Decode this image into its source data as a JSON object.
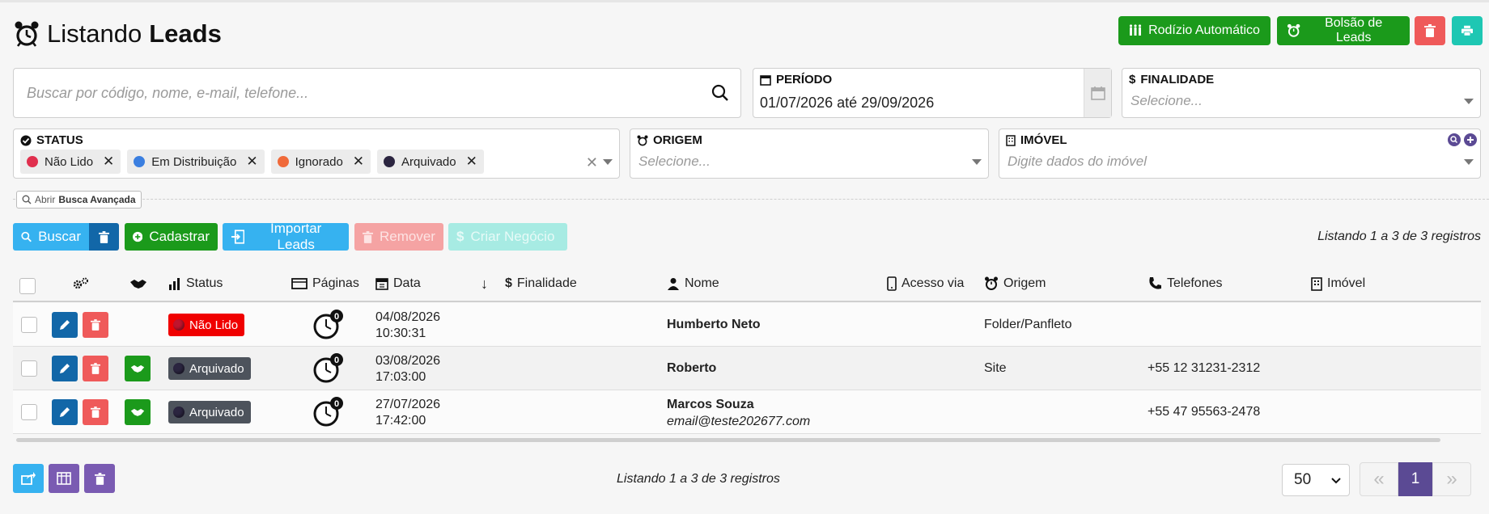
{
  "header": {
    "title_prefix": "Listando",
    "title_strong": "Leads",
    "btn_rodizio": "Rodízio Automático",
    "btn_bolsao": "Bolsão de Leads"
  },
  "filters": {
    "search_placeholder": "Buscar por código, nome, e-mail, telefone...",
    "periodo_label": "PERÍODO",
    "periodo_value": "01/07/2026 até 29/09/2026",
    "finalidade_label": "FINALIDADE",
    "finalidade_placeholder": "Selecione...",
    "status_label": "STATUS",
    "status_tags": [
      {
        "label": "Não Lido",
        "color": "#e0304e"
      },
      {
        "label": "Em Distribuição",
        "color": "#3b7fe0"
      },
      {
        "label": "Ignorado",
        "color": "#f06a3a"
      },
      {
        "label": "Arquivado",
        "color": "#2b2540"
      }
    ],
    "origem_label": "ORIGEM",
    "origem_placeholder": "Selecione...",
    "imovel_label": "IMÓVEL",
    "imovel_placeholder": "Digite dados do imóvel"
  },
  "advanced": {
    "prefix": "Abrir",
    "strong": "Busca Avançada"
  },
  "actions": {
    "buscar": "Buscar",
    "cadastrar": "Cadastrar",
    "importar": "Importar Leads",
    "remover": "Remover",
    "criar_negocio": "Criar Negócio",
    "listing_text": "Listando 1 a 3 de 3 registros"
  },
  "table": {
    "headers": {
      "status": "Status",
      "paginas": "Páginas",
      "data": "Data",
      "finalidade": "Finalidade",
      "nome": "Nome",
      "acesso": "Acesso via",
      "origem": "Origem",
      "telefones": "Telefones",
      "imovel": "Imóvel"
    },
    "rows": [
      {
        "status": "Não Lido",
        "pages": "0",
        "date": "04/08/2026",
        "time": "10:30:31",
        "name": "Humberto Neto",
        "email": "",
        "origem": "Folder/Panfleto",
        "phone": ""
      },
      {
        "status": "Arquivado",
        "pages": "0",
        "date": "03/08/2026",
        "time": "17:03:00",
        "name": "Roberto",
        "email": "",
        "origem": "Site",
        "phone": "+55 12 31231-2312"
      },
      {
        "status": "Arquivado",
        "pages": "0",
        "date": "27/07/2026",
        "time": "17:42:00",
        "name": "Marcos Souza",
        "email": "email@teste202677.com",
        "origem": "",
        "phone": "+55 47 95563-2478"
      }
    ]
  },
  "footer": {
    "listing_text": "Listando 1 a 3 de 3 registros",
    "per_page": "50",
    "current_page": "1"
  },
  "colors": {
    "green": "#1b9a1b",
    "red": "#ef5a5a",
    "teal": "#1ec7b3",
    "blue": "#36b2f0",
    "navy": "#1267a8",
    "purple": "#7a5bb2",
    "status_nao_lido": "#f00000",
    "status_arquivado": "#4d535c"
  }
}
